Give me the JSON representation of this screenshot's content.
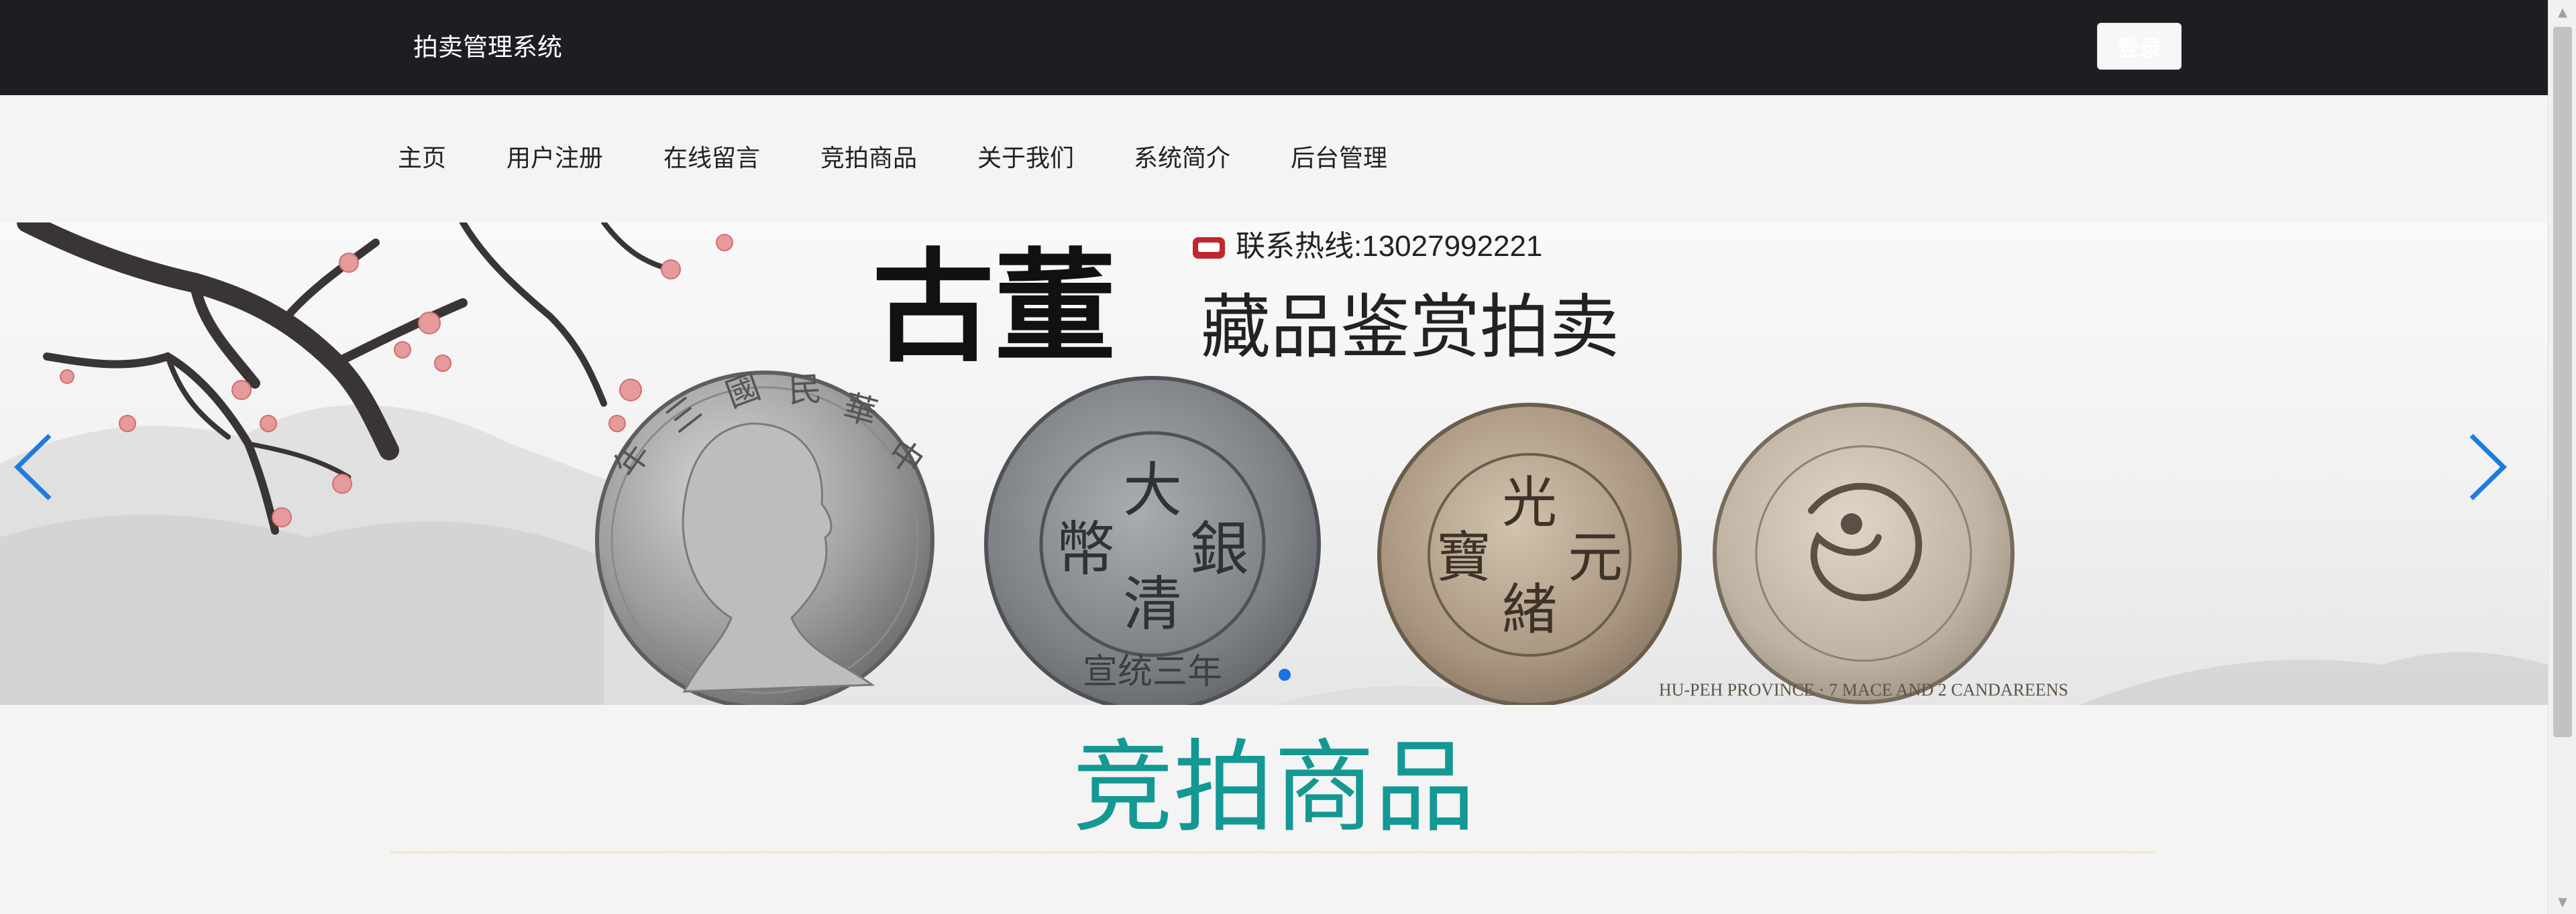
{
  "header": {
    "brand": "拍卖管理系统",
    "login_label": "登录"
  },
  "nav": {
    "items": [
      {
        "label": "主页"
      },
      {
        "label": "用户注册"
      },
      {
        "label": "在线留言"
      },
      {
        "label": "竞拍商品"
      },
      {
        "label": "关于我们"
      },
      {
        "label": "系统简介"
      },
      {
        "label": "后台管理"
      }
    ]
  },
  "banner": {
    "hotline": "联系热线:13027992221",
    "big_title": "古董",
    "subtitle": "藏品鉴赏拍卖",
    "active_slide": 1,
    "slide_count": 1,
    "coins": [
      {
        "chars": [
          "中",
          "華",
          "民",
          "國",
          "三",
          "年"
        ]
      },
      {
        "center": [
          "大",
          "清",
          "銀",
          "幣"
        ],
        "rim": "宣统三年"
      },
      {
        "center": [
          "光",
          "緒",
          "元",
          "寶"
        ]
      },
      {
        "rim": "HU-PEH PROVINCE · 7 MACE AND 2 CANDAREENS"
      }
    ],
    "colors": {
      "accent": "#1a73e8",
      "phone": "#c2272d"
    }
  },
  "section": {
    "title": "竞拍商品",
    "title_color": "#149893"
  }
}
